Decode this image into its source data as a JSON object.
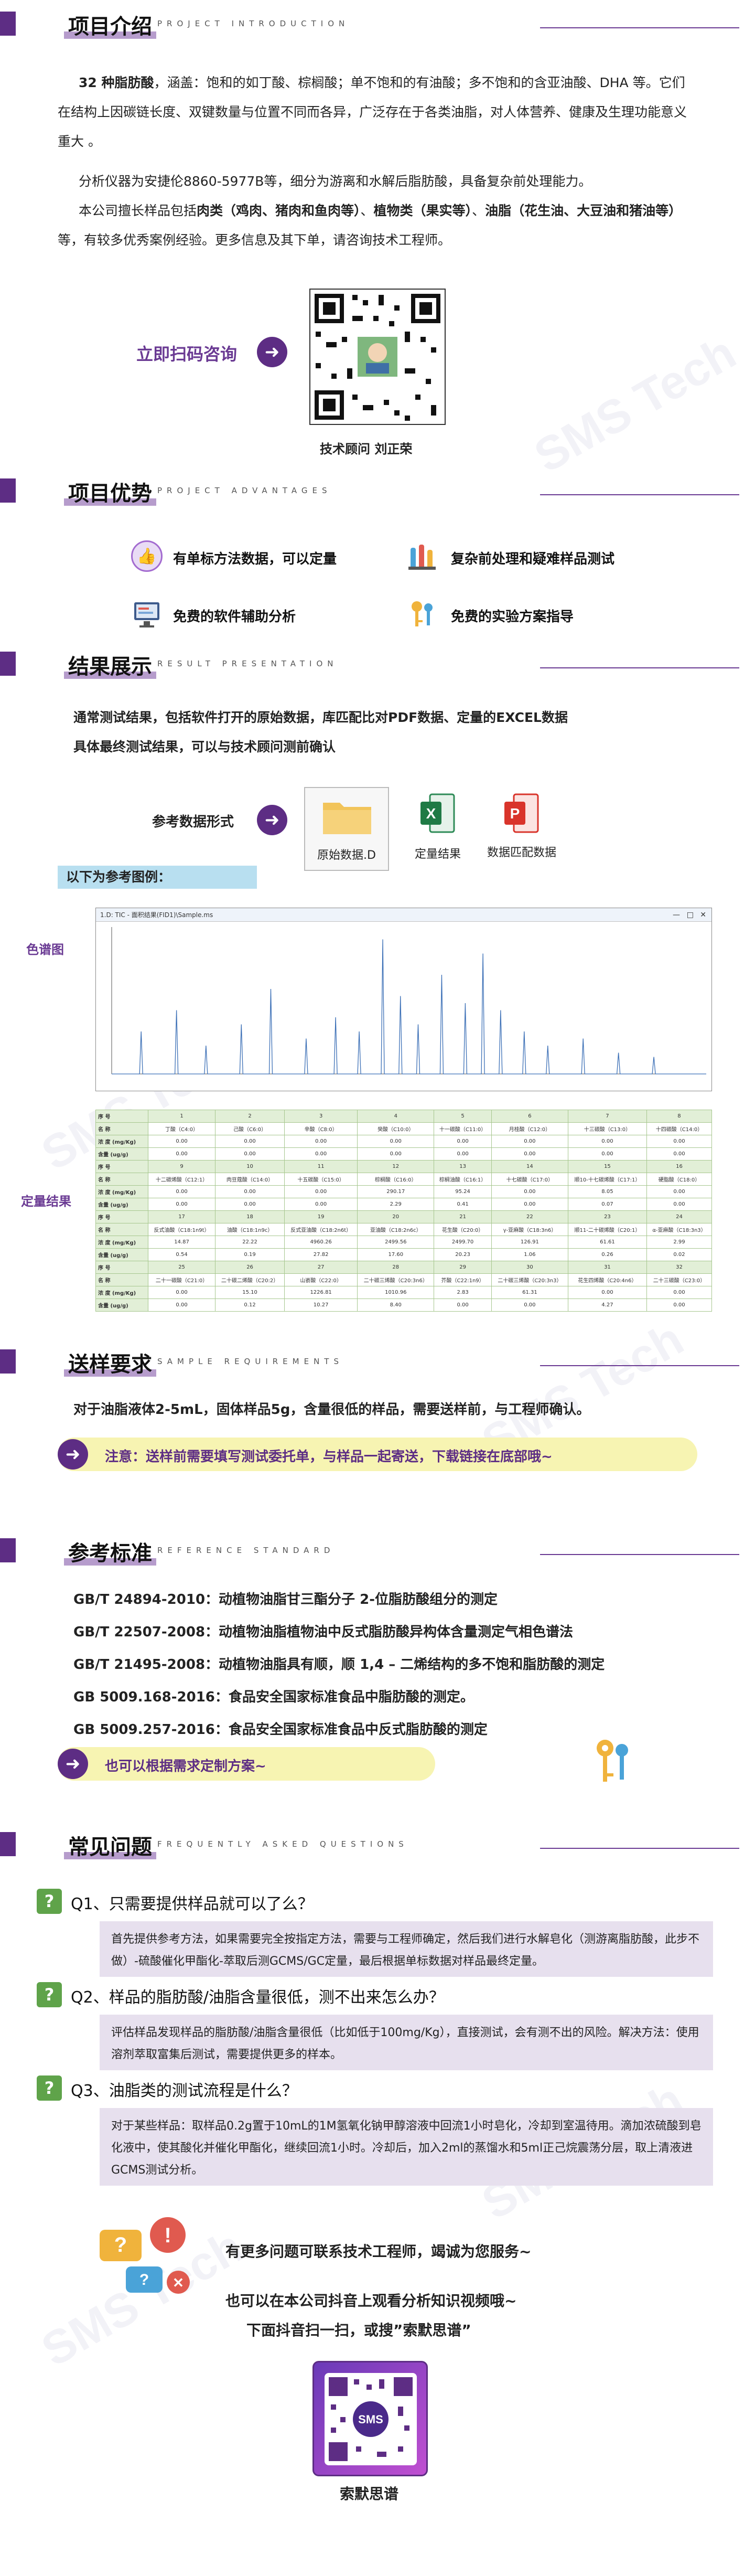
{
  "watermark": "SMS Tech",
  "sections": {
    "intro": {
      "title": "项目介绍",
      "en": "PROJECT INTRODUCTION"
    },
    "adv": {
      "title": "项目优势",
      "en": "PROJECT ADVANTAGES"
    },
    "result": {
      "title": "结果展示",
      "en": "RESULT PRESENTATION"
    },
    "sample": {
      "title": "送样要求",
      "en": "SAMPLE REQUIREMENTS"
    },
    "ref": {
      "title": "参考标准",
      "en": "REFERENCE STANDARD"
    },
    "faq": {
      "title": "常见问题",
      "en": "FREQUENTLY ASKED QUESTIONS"
    }
  },
  "intro": {
    "p1_bold": "32 种脂肪酸",
    "p1_rest": "，涵盖：饱和的如丁酸、棕榈酸；单不饱和的有油酸；多不饱和的含亚油酸、DHA 等。它们在结构上因碳链长度、双键数量与位置不同而各异，广泛存在于各类油脂，对人体营养、健康及生理功能意义重大 。",
    "p2": "分析仪器为安捷伦8860-5977B等，细分为游离和水解后脂肪酸，具备复杂前处理能力。",
    "p3_a": "本公司擅长样品包括",
    "p3_b": "肉类（鸡肉、猪肉和鱼肉等）",
    "p3_c": "、",
    "p3_d": "植物类（果实等）",
    "p3_e": "、",
    "p3_f": "油脂（花生油、大豆油和猪油等）",
    "p3_g": "等，有较多优秀案例经验。更多信息及其下单，请咨询技术工程师。",
    "scan_label": "立即扫码咨询",
    "contact": "技术顾问  刘正荣"
  },
  "advantages": [
    {
      "label": "有单标方法数据，可以定量",
      "icon": "thumbs-up-icon"
    },
    {
      "label": "复杂前处理和疑难样品测试",
      "icon": "flask-icon"
    },
    {
      "label": "免费的软件辅助分析",
      "icon": "computer-icon"
    },
    {
      "label": "免费的实验方案指导",
      "icon": "key-icon"
    }
  ],
  "result": {
    "line1": "通常测试结果，包括软件打开的原始数据，库匹配比对PDF数据、定量的EXCEL数据",
    "line2": "具体最终测试结果，可以与技术顾问测前确认",
    "ref_label": "参考数据形式",
    "files": [
      {
        "label": "原始数据.D",
        "icon": "folder-icon"
      },
      {
        "label": "定量结果",
        "icon": "excel-icon"
      },
      {
        "label": "数据匹配数据",
        "icon": "pdf-icon"
      }
    ],
    "example_bar": "以下为参考图例：",
    "chromatogram_label": "色谱图",
    "quant_label": "定量结果",
    "window_title": "1.D: TIC - 面积结果(FID1)\\Sample.ms"
  },
  "table": {
    "row_labels": [
      "序 号",
      "名 称",
      "浓 度 (mg/Kg)",
      "含量 (ug/g)"
    ],
    "blocks": [
      {
        "nums": [
          "1",
          "2",
          "3",
          "4",
          "5",
          "6",
          "7",
          "8"
        ],
        "names": [
          "丁酸（C4:0）",
          "己酸（C6:0）",
          "辛酸（C8:0）",
          "癸酸（C10:0）",
          "十一碳酸（C11:0）",
          "月桂酸（C12:0）",
          "十三碳酸（C13:0）",
          "十四碳酸（C14:0）"
        ],
        "conc": [
          "0.00",
          "0.00",
          "0.00",
          "0.00",
          "0.00",
          "0.00",
          "0.00",
          "0.00"
        ],
        "content": [
          "0.00",
          "0.00",
          "0.00",
          "0.00",
          "0.00",
          "0.00",
          "0.00",
          "0.00"
        ]
      },
      {
        "nums": [
          "9",
          "10",
          "11",
          "12",
          "13",
          "14",
          "15",
          "16"
        ],
        "names": [
          "十二碳烯酸（C12:1）",
          "肉豆蔻酸（C14:0）",
          "十五碳酸（C15:0）",
          "棕榈酸（C16:0）",
          "棕榈油酸（C16:1）",
          "十七碳酸（C17:0）",
          "顺10-十七碳烯酸（C17:1）",
          "硬脂酸（C18:0）"
        ],
        "conc": [
          "0.00",
          "0.00",
          "0.00",
          "290.17",
          "95.24",
          "0.00",
          "8.05",
          "0.00"
        ],
        "content": [
          "0.00",
          "0.00",
          "0.00",
          "2.29",
          "0.41",
          "0.00",
          "0.07",
          "0.00"
        ]
      },
      {
        "nums": [
          "17",
          "18",
          "19",
          "20",
          "21",
          "22",
          "23",
          "24"
        ],
        "names": [
          "反式油酸（C18:1n9t）",
          "油酸（C18:1n9c）",
          "反式亚油酸（C18:2n6t）",
          "亚油酸（C18:2n6c）",
          "花生酸（C20:0）",
          "γ-亚麻酸（C18:3n6）",
          "顺11-二十碳烯酸（C20:1）",
          "α-亚麻酸（C18:3n3）"
        ],
        "conc": [
          "14.87",
          "22.22",
          "4960.26",
          "2499.56",
          "2499.70",
          "126.91",
          "61.61",
          "2.99"
        ],
        "content": [
          "0.54",
          "0.19",
          "27.82",
          "17.60",
          "20.23",
          "1.06",
          "0.26",
          "0.02"
        ]
      },
      {
        "nums": [
          "25",
          "26",
          "27",
          "28",
          "29",
          "30",
          "31",
          "32"
        ],
        "names": [
          "二十一碳酸（C21:0）",
          "二十碳二烯酸（C20:2）",
          "山嵛酸（C22:0）",
          "二十碳三烯酸（C20:3n6）",
          "芥酸（C22:1n9）",
          "二十碳三烯酸（C20:3n3）",
          "花生四烯酸（C20:4n6）",
          "二十三碳酸（C23:0）"
        ],
        "conc": [
          "0.00",
          "15.10",
          "1226.81",
          "1010.96",
          "2.83",
          "61.31",
          "0.00",
          "0.00"
        ],
        "content": [
          "0.00",
          "0.12",
          "10.27",
          "8.40",
          "0.00",
          "0.00",
          "4.27",
          "0.00"
        ]
      }
    ]
  },
  "sample": {
    "line1": "对于油脂液体2-5mL，固体样品5g，含量很低的样品，需要送样前，与工程师确认。",
    "note": "注意：送样前需要填写测试委托单，与样品一起寄送，下载链接在底部哦~"
  },
  "standards": [
    "GB/T 24894-2010：动植物油脂甘三酯分子 2-位脂肪酸组分的测定",
    "GB/T 22507-2008：动植物油脂植物油中反式脂肪酸异构体含量测定气相色谱法",
    "GB/T 21495-2008：动植物油脂具有顺，顺 1,4 – 二烯结构的多不饱和脂肪酸的测定",
    "GB 5009.168-2016：食品安全国家标准食品中脂肪酸的测定。",
    "GB 5009.257-2016：食品安全国家标准食品中反式脂肪酸的测定"
  ],
  "custom_note": "也可以根据需求定制方案~",
  "faq": [
    {
      "q": "Q1、只需要提供样品就可以了么？",
      "a": "首先提供参考方法，如果需要完全按指定方法，需要与工程师确定，然后我们进行水解皂化（测游离脂肪酸，此步不做）-硫酸催化甲酯化-萃取后测GCMS/GC定量，最后根据单标数据对样品最终定量。"
    },
    {
      "q": "Q2、样品的脂肪酸/油脂含量很低，测不出来怎么办？",
      "a": "评估样品发现样品的脂肪酸/油脂含量很低（比如低于100mg/Kg），直接测试，会有测不出的风险。解决方法：使用溶剂萃取富集后测试，需要提供更多的样本。"
    },
    {
      "q": "Q3、油脂类的测试流程是什么？",
      "a": "对于某些样品：取样品0.2g置于10mL的1M氢氧化钠甲醇溶液中回流1小时皂化，冷却到室温待用。滴加浓硫酸到皂化液中，使其酸化并催化甲酯化，继续回流1小时。冷却后，加入2ml的蒸馏水和5ml正己烷震荡分层，取上清液进GCMS测试分析。"
    }
  ],
  "footer": {
    "line1": "有更多问题可联系技术工程师，竭诚为您服务~",
    "line2": "也可以在本公司抖音上观看分析知识视频哦~",
    "line3": "下面抖音扫一扫，或搜”索默思谱”",
    "name": "索默思谱",
    "logo_text": "SMS"
  },
  "colors": {
    "purple": "#5d2d84",
    "light_purple": "#e7e0ee",
    "yellow": "#f7f4b2",
    "green": "#a7c78f"
  }
}
